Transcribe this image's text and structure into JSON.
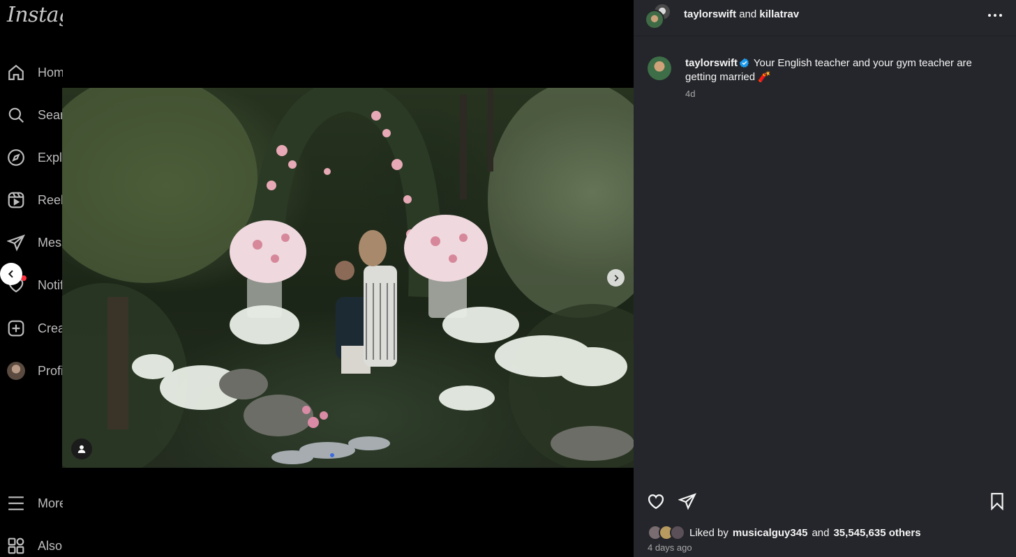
{
  "sidebar": {
    "logo": "Instagram",
    "items": [
      {
        "label": "Home",
        "icon": "home-icon"
      },
      {
        "label": "Search",
        "icon": "search-icon"
      },
      {
        "label": "Explore",
        "icon": "explore-icon"
      },
      {
        "label": "Reels",
        "icon": "reels-icon"
      },
      {
        "label": "Messages",
        "icon": "messages-icon"
      },
      {
        "label": "Notifications",
        "icon": "heart-icon"
      },
      {
        "label": "Create",
        "icon": "create-icon"
      },
      {
        "label": "Profile",
        "icon": "avatar"
      },
      {
        "label": "More",
        "icon": "menu-icon"
      },
      {
        "label": "Also from Meta",
        "icon": "apps-icon"
      }
    ]
  },
  "post": {
    "header": {
      "author": "taylorswift",
      "joiner": "and",
      "collaborator": "killatrav"
    },
    "caption": {
      "author": "taylorswift",
      "text": "Your English teacher and your gym teacher are getting married 🧨",
      "time": "4d"
    },
    "likes": {
      "prefix": "Liked by",
      "user": "musicalguy345",
      "joiner": "and",
      "others": "35,545,635 others"
    },
    "date": "4 days ago"
  },
  "colors": {
    "panel_bg": "#25262b",
    "verified_blue": "#1d9bf0",
    "notification_red": "#ff3040"
  }
}
